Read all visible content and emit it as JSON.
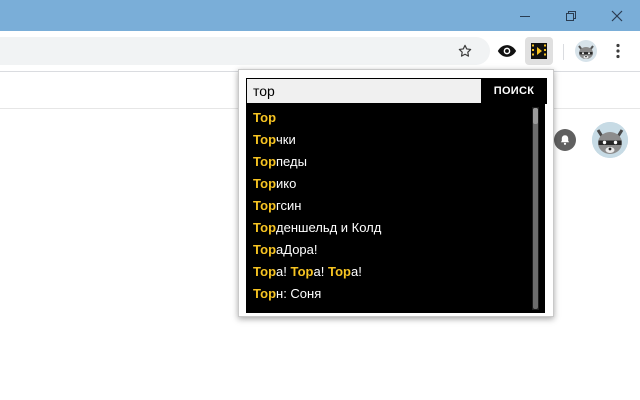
{
  "window": {
    "controls": [
      "minimize-icon",
      "restore-icon",
      "close-icon"
    ]
  },
  "toolbar": {
    "icons": [
      "star-icon",
      "eye-icon",
      "film-icon",
      "raccoon-avatar",
      "more-vert-icon"
    ]
  },
  "page": {
    "icons": [
      "bell-icon",
      "raccoon-avatar"
    ]
  },
  "popup": {
    "search_value": "тор",
    "search_button": "ПОИСК",
    "highlight_color": "#f7c422",
    "results": [
      {
        "hl": "Тор",
        "rest": ""
      },
      {
        "hl": "Тор",
        "rest": "чки"
      },
      {
        "hl": "Тор",
        "rest": "педы"
      },
      {
        "hl": "Тор",
        "rest": "ико"
      },
      {
        "hl": "Тор",
        "rest": "гсин"
      },
      {
        "hl": "Тор",
        "rest": "деншельд и Колд"
      },
      {
        "hl": "Тор",
        "rest": "аДора!"
      },
      {
        "hl": "Тор",
        "rest": "а! ",
        "hl2": "Тор",
        "rest2": "а! ",
        "hl3": "Тор",
        "rest3": "а!"
      },
      {
        "hl": "Тор",
        "rest": "н: Соня"
      }
    ]
  }
}
